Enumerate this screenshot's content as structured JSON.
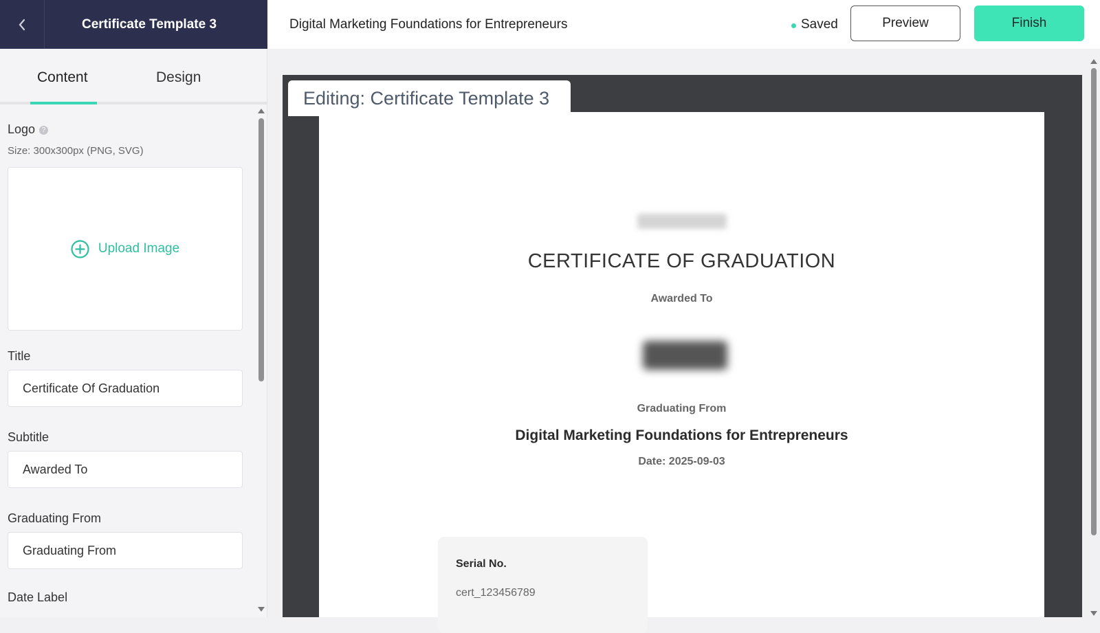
{
  "sidebar_header": {
    "title": "Certificate Template 3",
    "back_icon": "chevron-left-icon"
  },
  "top_bar": {
    "course_title": "Digital Marketing Foundations for Entrepreneurs",
    "status": "Saved",
    "status_color": "#3bd6b4",
    "preview_label": "Preview",
    "finish_label": "Finish",
    "accent_color": "#3ee3b6"
  },
  "tabs": [
    {
      "label": "Content",
      "active": true
    },
    {
      "label": "Design",
      "active": false
    }
  ],
  "form": {
    "logo_label": "Logo",
    "logo_hint": "Size: 300x300px (PNG, SVG)",
    "upload_label": "Upload Image",
    "title_label": "Title",
    "title_value": "Certificate Of Graduation",
    "subtitle_label": "Subtitle",
    "subtitle_value": "Awarded To",
    "graduating_label": "Graduating From",
    "graduating_value": "Graduating From",
    "date_label": "Date Label"
  },
  "canvas": {
    "editing_label": "Editing: Certificate Template 3",
    "certificate": {
      "title": "CERTIFICATE OF GRADUATION",
      "awarded_to": "Awarded To",
      "graduating_from": "Graduating From",
      "course": "Digital Marketing Foundations for Entrepreneurs",
      "date": "Date: 2025-09-03",
      "serial_label": "Serial No.",
      "serial_value": "cert_123456789"
    }
  }
}
